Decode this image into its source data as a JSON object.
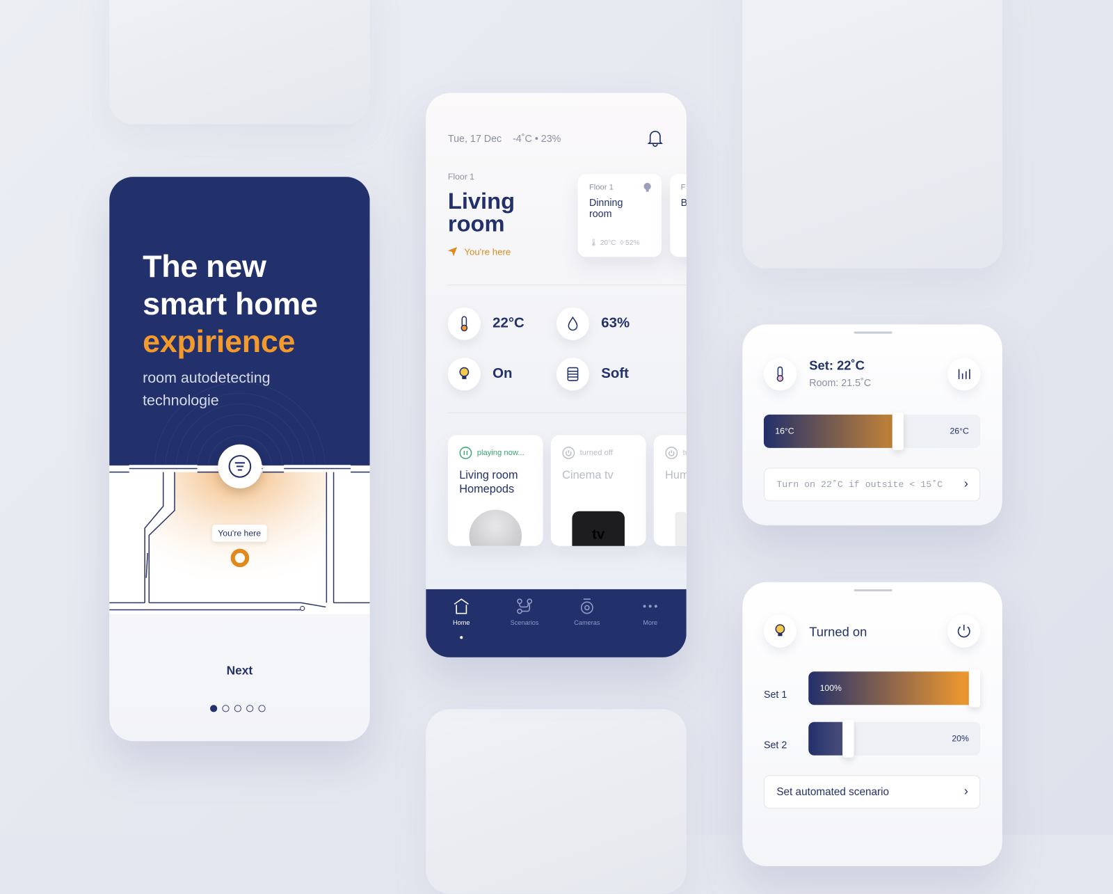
{
  "onboarding": {
    "title_line1": "The new",
    "title_line2": "smart home",
    "title_accent": "expirience",
    "subtitle": "room autodetecting technologie",
    "map_label": "You're here",
    "next_label": "Next",
    "page_count": 5,
    "current_page": 1
  },
  "home": {
    "date": "Tue, 17 Dec",
    "weather": "-4˚C",
    "humidity": "23%",
    "floor": "Floor 1",
    "room_title": "Living room",
    "location_label": "You're here",
    "other_rooms": [
      {
        "floor": "Floor 1",
        "name": "Dinning room",
        "temp": "20°C",
        "humidity": "52%"
      },
      {
        "floor": "F",
        "name": "B"
      }
    ],
    "stats": {
      "temperature": "22°C",
      "humidity": "63%",
      "light": "On",
      "mode": "Soft"
    },
    "devices": [
      {
        "status": "playing now...",
        "name": "Living room Homepods",
        "state": "playing"
      },
      {
        "status": "turned off",
        "name": "Cinema tv",
        "state": "off",
        "logo": "tv"
      },
      {
        "status": "tu",
        "name": "Hum",
        "state": "off"
      }
    ],
    "nav": [
      {
        "label": "Home",
        "icon": "home-icon",
        "active": true
      },
      {
        "label": "Scenarios",
        "icon": "scenarios-icon"
      },
      {
        "label": "Cameras",
        "icon": "camera-icon"
      },
      {
        "label": "More",
        "icon": "more-icon"
      }
    ]
  },
  "thermostat": {
    "set": "Set: 22˚C",
    "room": "Room: 21.5˚C",
    "min": "16°C",
    "max": "26°C",
    "level_percent": 60,
    "scenario": "Turn on 22˚C if outsite < 15˚C"
  },
  "light": {
    "status": "Turned on",
    "sets": [
      {
        "label": "Set 1",
        "value": "100%",
        "percent": 100
      },
      {
        "label": "Set 2",
        "value": "20%",
        "percent": 20
      }
    ],
    "scenario": "Set automated scenario"
  },
  "colors": {
    "navy": "#22306b",
    "accent": "#f29a2e",
    "green": "#3aa66b"
  }
}
